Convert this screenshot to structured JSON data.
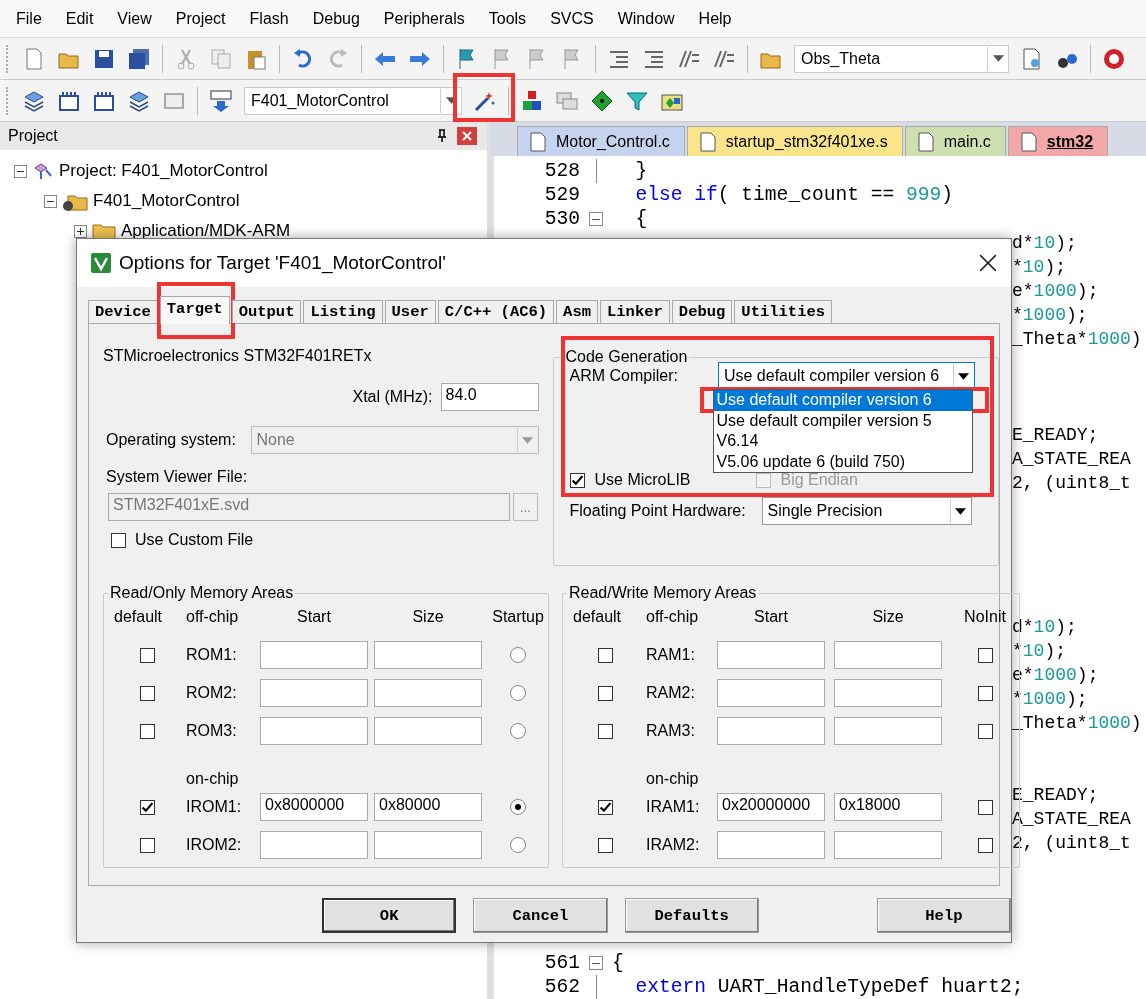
{
  "menu": [
    "File",
    "Edit",
    "View",
    "Project",
    "Flash",
    "Debug",
    "Peripherals",
    "Tools",
    "SVCS",
    "Window",
    "Help"
  ],
  "toolbar_1": {
    "find_select": "Obs_Theta"
  },
  "toolbar_2": {
    "target_select": "F401_MotorControl",
    "options_button": {
      "highlighted": true
    }
  },
  "project_pane": {
    "title": "Project",
    "tree": [
      {
        "label": "Project: F401_MotorControl",
        "kind": "project",
        "expanded": true,
        "children": [
          {
            "label": "F401_MotorControl",
            "kind": "target",
            "expanded": true,
            "children": [
              {
                "label": "Application/MDK-ARM",
                "kind": "group",
                "expanded": false
              }
            ]
          }
        ]
      }
    ]
  },
  "editor": {
    "tabs": [
      {
        "label": "Motor_Control.c",
        "color": "#c5d3ee",
        "selected": false
      },
      {
        "label": "startup_stm32f401xe.s",
        "color": "#fbe58a",
        "selected": false
      },
      {
        "label": "main.c",
        "color": "#cfe0b0",
        "selected": false
      },
      {
        "label": "stm32",
        "color": "#f2a8a8",
        "selected": true
      }
    ],
    "lines": [
      {
        "kind": "full",
        "number": "528",
        "fold": {
          "kind": "line"
        },
        "code": [
          {
            "kind": "plain",
            "t": "  }"
          }
        ]
      },
      {
        "kind": "full",
        "number": "529",
        "fold": {
          "kind": "none"
        },
        "code": [
          {
            "kind": "keyword",
            "t": "  else if"
          },
          {
            "kind": "plain",
            "t": "( time_count == "
          },
          {
            "kind": "number",
            "t": "999"
          },
          {
            "kind": "plain",
            "t": ")"
          }
        ]
      },
      {
        "kind": "full",
        "number": "530",
        "fold": {
          "kind": "box"
        },
        "code": [
          {
            "kind": "plain",
            "t": "  {"
          }
        ]
      },
      {
        "kind": "tail",
        "code": [
          {
            "kind": "plain",
            "t": "d*"
          },
          {
            "kind": "number",
            "t": "10"
          },
          {
            "kind": "plain",
            "t": ");"
          }
        ]
      },
      {
        "kind": "tail",
        "code": [
          {
            "kind": "plain",
            "t": "*"
          },
          {
            "kind": "number",
            "t": "10"
          },
          {
            "kind": "plain",
            "t": ");"
          }
        ]
      },
      {
        "kind": "tail",
        "code": [
          {
            "kind": "plain",
            "t": "e*"
          },
          {
            "kind": "number",
            "t": "1000"
          },
          {
            "kind": "plain",
            "t": ");"
          }
        ]
      },
      {
        "kind": "tail",
        "code": [
          {
            "kind": "plain",
            "t": "*"
          },
          {
            "kind": "number",
            "t": "1000"
          },
          {
            "kind": "plain",
            "t": ");"
          }
        ]
      },
      {
        "kind": "tail",
        "code": [
          {
            "kind": "plain",
            "t": "_Theta*"
          },
          {
            "kind": "number",
            "t": "1000"
          },
          {
            "kind": "plain",
            "t": ")"
          }
        ]
      },
      {
        "kind": "blank"
      },
      {
        "kind": "blank"
      },
      {
        "kind": "blank"
      },
      {
        "kind": "tail",
        "code": [
          {
            "kind": "plain",
            "t": "E_READY;"
          }
        ]
      },
      {
        "kind": "tail",
        "code": [
          {
            "kind": "plain",
            "t": "A_STATE_REA"
          }
        ]
      },
      {
        "kind": "tail",
        "code": [
          {
            "kind": "plain",
            "t": "2, (uint8_t"
          }
        ]
      },
      {
        "kind": "blank"
      },
      {
        "kind": "blank"
      },
      {
        "kind": "blank"
      },
      {
        "kind": "blank"
      },
      {
        "kind": "blank"
      },
      {
        "kind": "tail",
        "code": [
          {
            "kind": "plain",
            "t": "d*"
          },
          {
            "kind": "number",
            "t": "10"
          },
          {
            "kind": "plain",
            "t": ");"
          }
        ]
      },
      {
        "kind": "tail",
        "code": [
          {
            "kind": "plain",
            "t": "*"
          },
          {
            "kind": "number",
            "t": "10"
          },
          {
            "kind": "plain",
            "t": ");"
          }
        ]
      },
      {
        "kind": "tail",
        "code": [
          {
            "kind": "plain",
            "t": "e*"
          },
          {
            "kind": "number",
            "t": "1000"
          },
          {
            "kind": "plain",
            "t": ");"
          }
        ]
      },
      {
        "kind": "tail",
        "code": [
          {
            "kind": "plain",
            "t": "*"
          },
          {
            "kind": "number",
            "t": "1000"
          },
          {
            "kind": "plain",
            "t": ");"
          }
        ]
      },
      {
        "kind": "tail",
        "code": [
          {
            "kind": "plain",
            "t": "_Theta*"
          },
          {
            "kind": "number",
            "t": "1000"
          },
          {
            "kind": "plain",
            "t": ")"
          }
        ]
      },
      {
        "kind": "blank"
      },
      {
        "kind": "blank"
      },
      {
        "kind": "tail",
        "code": [
          {
            "kind": "plain",
            "t": "E_READY;"
          }
        ]
      },
      {
        "kind": "tail",
        "code": [
          {
            "kind": "plain",
            "t": "A_STATE_REA"
          }
        ]
      },
      {
        "kind": "tail",
        "code": [
          {
            "kind": "plain",
            "t": "2, (uint8_t"
          }
        ]
      },
      {
        "kind": "blank"
      },
      {
        "kind": "blank"
      },
      {
        "kind": "blank"
      },
      {
        "kind": "blank"
      },
      {
        "kind": "full",
        "number": "561",
        "fold": {
          "kind": "box"
        },
        "code": [
          {
            "kind": "plain",
            "t": "{"
          }
        ]
      },
      {
        "kind": "full",
        "number": "562",
        "fold": {
          "kind": "line"
        },
        "code": [
          {
            "kind": "keyword",
            "t": "  extern"
          },
          {
            "kind": "plain",
            "t": " UART_HandleTypeDef huart2;"
          }
        ]
      }
    ]
  },
  "dialog": {
    "title": "Options for Target 'F401_MotorControl'",
    "tabs": [
      {
        "label": "Device",
        "selected": false,
        "highlighted": false
      },
      {
        "label": "Target",
        "selected": true,
        "highlighted": true
      },
      {
        "label": "Output",
        "selected": false,
        "highlighted": false
      },
      {
        "label": "Listing",
        "selected": false,
        "highlighted": false
      },
      {
        "label": "User",
        "selected": false,
        "highlighted": false
      },
      {
        "label": "C/C++ (AC6)",
        "selected": false,
        "highlighted": false
      },
      {
        "label": "Asm",
        "selected": false,
        "highlighted": false
      },
      {
        "label": "Linker",
        "selected": false,
        "highlighted": false
      },
      {
        "label": "Debug",
        "selected": false,
        "highlighted": false
      },
      {
        "label": "Utilities",
        "selected": false,
        "highlighted": false
      }
    ],
    "device": "STMicroelectronics STM32F401RETx",
    "xtal": {
      "label": "Xtal (MHz):",
      "value": "84.0"
    },
    "operating_system": {
      "label": "Operating system:",
      "value": "None",
      "disabled": true
    },
    "system_viewer": {
      "label": "System Viewer File:",
      "value": "STM32F401xE.svd",
      "disabled": true,
      "browse": "..."
    },
    "use_custom_file": {
      "label": "Use Custom File",
      "checked": false
    },
    "code_generation": {
      "title": "Code Generation",
      "highlighted": true,
      "compiler": {
        "label": "ARM Compiler:",
        "value": "Use default compiler version 6",
        "expanded": true,
        "options": [
          {
            "label": "Use default compiler version 6",
            "selected": true,
            "highlighted": true
          },
          {
            "label": "Use default compiler version 5",
            "selected": false,
            "highlighted": false
          },
          {
            "label": "V6.14",
            "selected": false,
            "highlighted": false
          },
          {
            "label": "V5.06 update 6 (build 750)",
            "selected": false,
            "highlighted": false
          }
        ]
      },
      "use_microlib": {
        "label": "Use MicroLIB",
        "checked": true,
        "disabled": false
      },
      "big_endian": {
        "label": "Big Endian",
        "checked": false,
        "disabled": true
      },
      "fpu": {
        "label": "Floating Point Hardware:",
        "value": "Single Precision"
      }
    },
    "ro_memory": {
      "title": "Read/Only Memory Areas",
      "columns": [
        "default",
        "off-chip",
        "Start",
        "Size",
        "Startup"
      ],
      "rows": [
        {
          "name": "ROM1:",
          "default": false,
          "start": "",
          "size": "",
          "selected": false
        },
        {
          "name": "ROM2:",
          "default": false,
          "start": "",
          "size": "",
          "selected": false
        },
        {
          "name": "ROM3:",
          "default": false,
          "start": "",
          "size": "",
          "selected": false
        }
      ],
      "onchip": {
        "label": "on-chip",
        "rows": [
          {
            "name": "IROM1:",
            "default": true,
            "start": "0x8000000",
            "size": "0x80000",
            "selected": true
          },
          {
            "name": "IROM2:",
            "default": false,
            "start": "",
            "size": "",
            "selected": false
          }
        ]
      }
    },
    "rw_memory": {
      "title": "Read/Write Memory Areas",
      "columns": [
        "default",
        "off-chip",
        "Start",
        "Size",
        "NoInit"
      ],
      "rows": [
        {
          "name": "RAM1:",
          "default": false,
          "start": "",
          "size": "",
          "noinit": false
        },
        {
          "name": "RAM2:",
          "default": false,
          "start": "",
          "size": "",
          "noinit": false
        },
        {
          "name": "RAM3:",
          "default": false,
          "start": "",
          "size": "",
          "noinit": false
        }
      ],
      "onchip": {
        "label": "on-chip",
        "rows": [
          {
            "name": "IRAM1:",
            "default": true,
            "start": "0x20000000",
            "size": "0x18000",
            "noinit": false
          },
          {
            "name": "IRAM2:",
            "default": false,
            "start": "",
            "size": "",
            "noinit": false
          }
        ]
      }
    },
    "buttons": [
      {
        "label": "OK",
        "kind": "primary"
      },
      {
        "label": "Cancel",
        "kind": "normal"
      },
      {
        "label": "Defaults",
        "kind": "normal"
      },
      {
        "label": "Help",
        "kind": "help"
      }
    ]
  }
}
